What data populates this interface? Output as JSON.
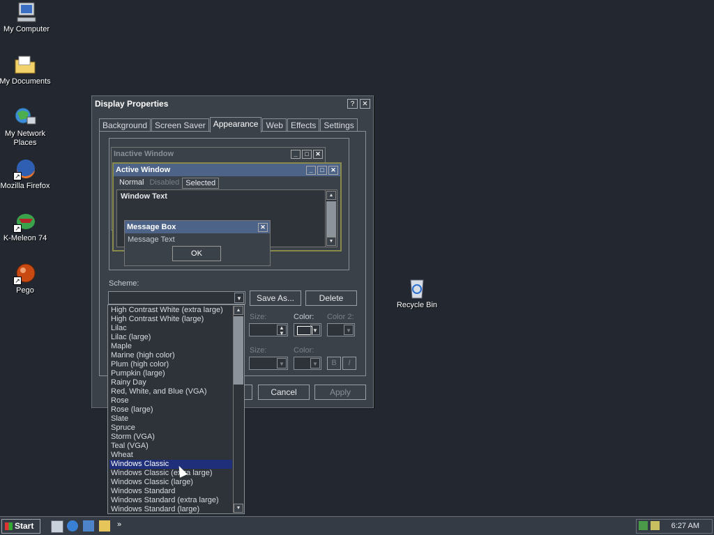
{
  "desktop": {
    "icons": [
      {
        "label": "My Computer",
        "icon": "computer-icon"
      },
      {
        "label": "My Documents",
        "icon": "folder-icon"
      },
      {
        "label": "My Network Places",
        "icon": "network-icon"
      },
      {
        "label": "Mozilla Firefox",
        "icon": "firefox-icon"
      },
      {
        "label": "K-Meleon 74",
        "icon": "kmeleon-icon"
      },
      {
        "label": "Pego",
        "icon": "pego-icon"
      },
      {
        "label": "Recycle Bin",
        "icon": "recycle-bin-icon"
      }
    ]
  },
  "dialog": {
    "title": "Display Properties",
    "help": "?",
    "close": "✕",
    "tabs": [
      "Background",
      "Screen Saver",
      "Appearance",
      "Web",
      "Effects",
      "Settings"
    ],
    "active_tab": "Appearance",
    "preview": {
      "inactive_title": "Inactive Window",
      "active_title": "Active Window",
      "menu": [
        "Normal",
        "Disabled",
        "Selected"
      ],
      "window_text": "Window Text",
      "msg_title": "Message Box",
      "msg_text": "Message Text",
      "ok": "OK"
    },
    "scheme_label": "Scheme:",
    "scheme_value": "",
    "save_as": "Save As...",
    "delete": "Delete",
    "size_label": "Size:",
    "color_label": "Color:",
    "color2_label": "Color 2:",
    "size_label_2": "Size:",
    "color_label_2": "Color:",
    "bold": "B",
    "italic": "I",
    "cancel": "Cancel",
    "apply": "Apply",
    "scheme_options": [
      "High Contrast White (extra large)",
      "High Contrast White (large)",
      "Lilac",
      "Lilac (large)",
      "Maple",
      "Marine (high color)",
      "Plum (high color)",
      "Pumpkin (large)",
      "Rainy Day",
      "Red, White, and Blue (VGA)",
      "Rose",
      "Rose (large)",
      "Slate",
      "Spruce",
      "Storm (VGA)",
      "Teal (VGA)",
      "Wheat",
      "Windows Classic",
      "Windows Classic (extra large)",
      "Windows Classic (large)",
      "Windows Standard",
      "Windows Standard (extra large)",
      "Windows Standard (large)"
    ],
    "selected_option": "Windows Classic"
  },
  "taskbar": {
    "start": "Start",
    "clock": "6:27 AM"
  },
  "colors": {
    "desktop": "#232830",
    "active_title": "#4d6488",
    "selection": "#1f2f7a"
  }
}
